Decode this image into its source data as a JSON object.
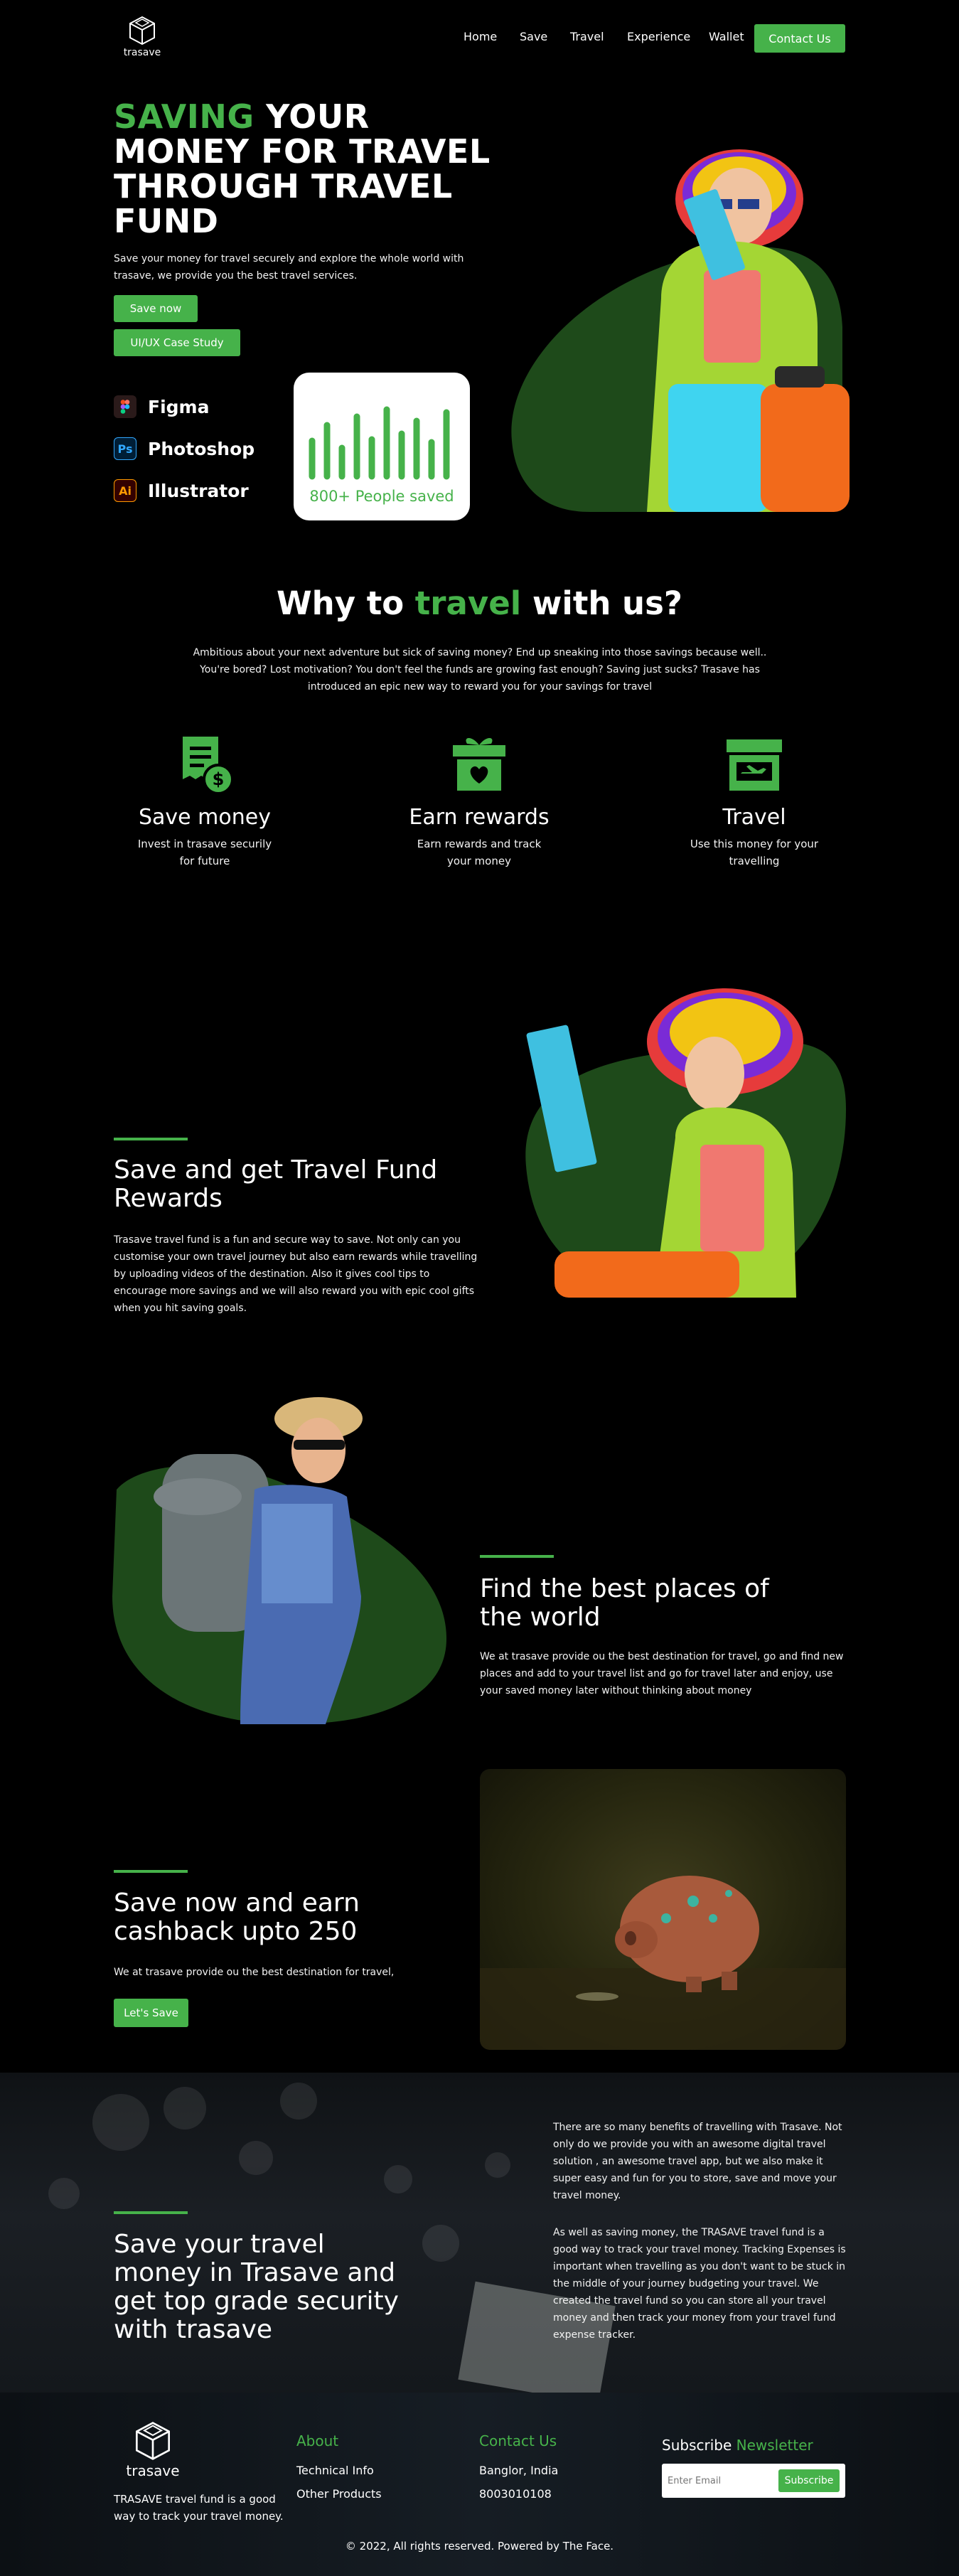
{
  "brand": {
    "name": "trasave",
    "accent": "#46b24a"
  },
  "nav": {
    "items": [
      "Home",
      "Save",
      "Travel",
      "Experience",
      "Wallet"
    ],
    "cta": "Contact Us"
  },
  "hero": {
    "title_highlight": "SAVING",
    "title_rest_line1": " YOUR",
    "title_line2": "MONEY FOR TRAVEL",
    "title_line3": "THROUGH TRAVEL",
    "title_line4": "FUND",
    "description": "Save your money for travel securely and explore the whole world with trasave, we provide you the best travel services.",
    "btn_save": "Save now",
    "btn_case": "UI/UX Case Study",
    "tools": [
      {
        "label": "Figma",
        "icon": "figma-icon"
      },
      {
        "label": "Photoshop",
        "icon": "photoshop-icon",
        "abbr": "Ps"
      },
      {
        "label": "Illustrator",
        "icon": "illustrator-icon",
        "abbr": "Ai"
      }
    ],
    "saved_card": {
      "label": "800+ People saved"
    }
  },
  "why": {
    "title_pre": "Why to ",
    "title_highlight": "travel",
    "title_post": " with us?",
    "description": "Ambitious about your next adventure but sick of saving money? End up sneaking into those savings because well.. You're bored? Lost motivation? You don't feel the funds are growing fast enough? Saving just sucks? Trasave has introduced an epic new way to reward you for your savings for travel",
    "features": [
      {
        "title": "Save money",
        "desc": "Invest in trasave securily for future",
        "icon": "receipt-dollar-icon"
      },
      {
        "title": "Earn rewards",
        "desc": "Earn rewards and track your money",
        "icon": "gift-heart-icon"
      },
      {
        "title": "Travel",
        "desc": "Use this money for your travelling",
        "icon": "airport-icon"
      }
    ]
  },
  "section_rewards": {
    "title": "Save and get Travel Fund Rewards",
    "description": "Trasave travel fund is a fun and secure way to save. Not only can you customise your own travel journey but also earn rewards while travelling by uploading videos of the destination. Also it gives cool tips to encourage more savings and we will also reward you with epic cool gifts when you hit saving goals."
  },
  "section_places": {
    "title": "Find the best places of the world",
    "description": "We at trasave provide ou the best destination for travel, go and find new places and add to your travel list and go for travel later and enjoy, use your saved money later without thinking about money"
  },
  "section_cashback": {
    "title": "Save now and earn cashback upto 250",
    "description": "We at trasave provide ou the best destination for travel,",
    "button": "Let's Save"
  },
  "section_security": {
    "title": "Save your travel money in Trasave and get top grade security with trasave",
    "para1": "There are so many benefits of travelling with Trasave. Not only do we provide you with an awesome digital travel solution , an awesome travel app, but we also make it super easy and fun for you to store, save and move your travel money.",
    "para2": "As well as saving money, the TRASAVE travel fund is a good way to track your travel money. Tracking Expenses is important when travelling as you don't want to be stuck in the middle of your journey budgeting your travel. We created the travel fund so you can store all your travel money and then track your money from your travel fund expense tracker."
  },
  "footer": {
    "brand_desc": "TRASAVE travel fund is a good way to track your travel money.",
    "about_title": "About",
    "about_links": [
      "Technical Info",
      "Other Products"
    ],
    "contact_title": "Contact Us",
    "contact_lines": [
      "Banglor, India",
      "8003010108"
    ],
    "subscribe_pre": "Subscribe ",
    "subscribe_highlight": "Newsletter",
    "email_placeholder": "Enter Email",
    "subscribe_button": "Subscribe",
    "copyright": "© 2022, All rights reserved. Powered by The Face."
  }
}
